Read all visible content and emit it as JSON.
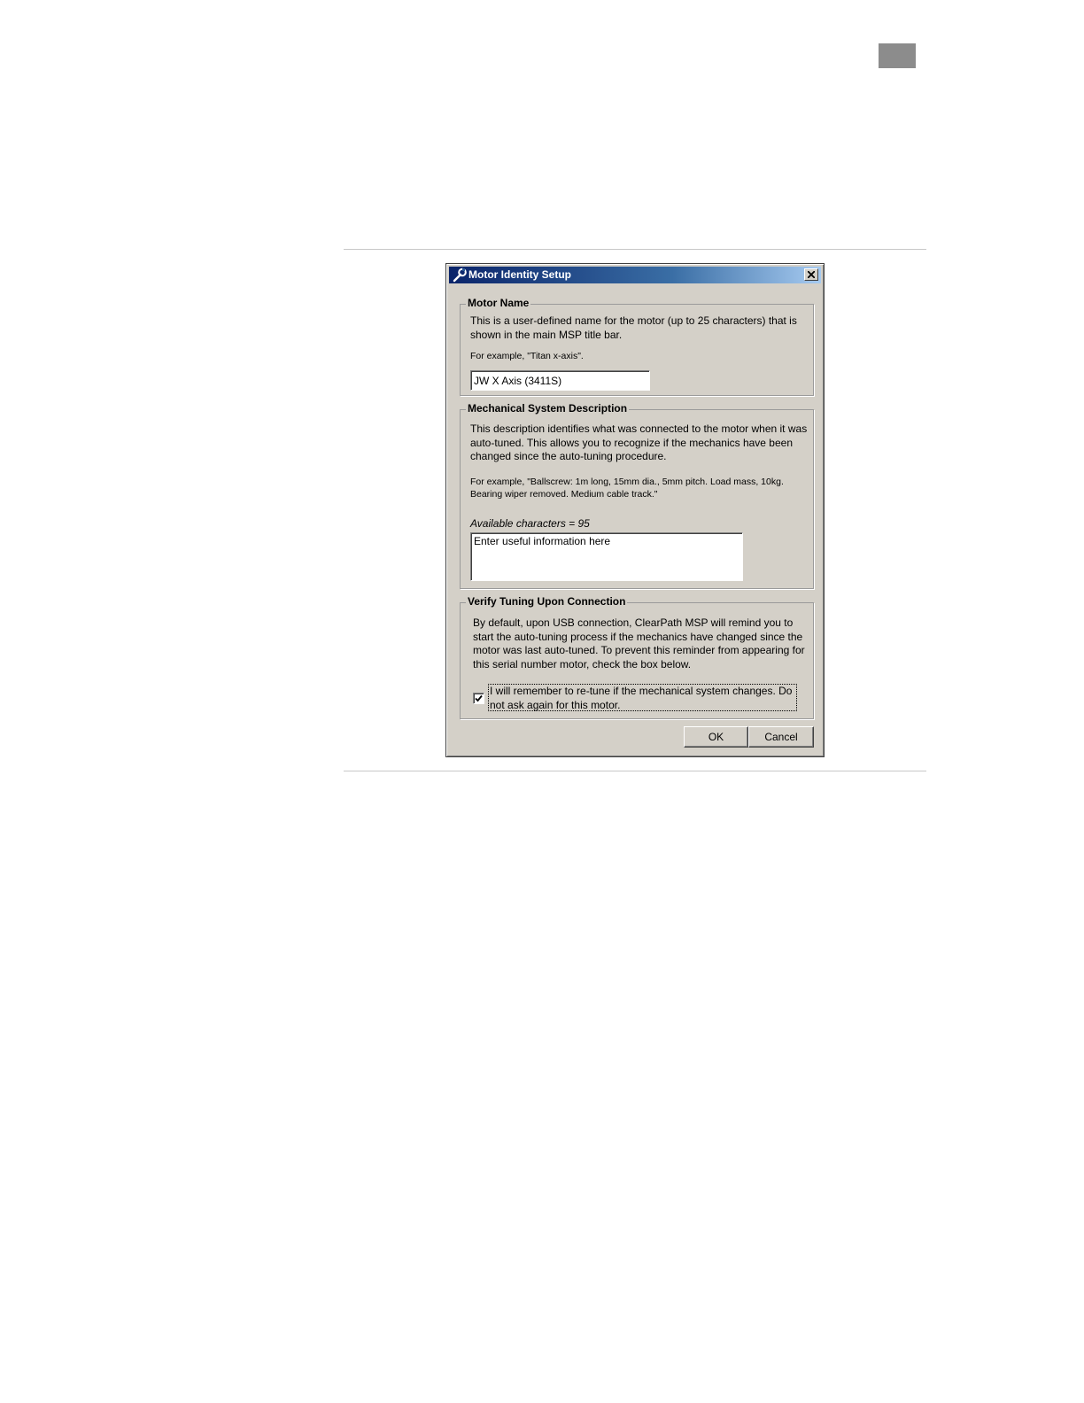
{
  "dialog": {
    "title": "Motor Identity Setup",
    "close_symbol": "×"
  },
  "motor_name": {
    "legend": "Motor Name",
    "description": "This is a user-defined name for the motor (up to 25 characters) that is shown in the main MSP title bar.",
    "example": "For example, \"Titan x-axis\".",
    "value": "JW X Axis (3411S)"
  },
  "mechanical": {
    "legend": "Mechanical System Description",
    "description": "This description identifies what was connected to the motor when it was auto-tuned. This allows you to recognize if the mechanics have been changed since the auto-tuning procedure.",
    "example": "For example, \"Ballscrew: 1m long, 15mm dia., 5mm pitch. Load mass, 10kg. Bearing wiper removed. Medium cable track.\"",
    "available_label": "Available characters = 95",
    "value": "Enter useful information here"
  },
  "verify": {
    "legend": "Verify Tuning Upon Connection",
    "description": "By default, upon USB connection, ClearPath MSP will remind you to start the auto-tuning process if the mechanics have changed since the motor was last auto-tuned. To prevent this reminder from appearing for this serial number motor, check the box below.",
    "checkbox_label": "I will remember to re-tune if the mechanical system changes. Do not ask again for this motor.",
    "checked": true
  },
  "buttons": {
    "ok": "OK",
    "cancel": "Cancel"
  }
}
